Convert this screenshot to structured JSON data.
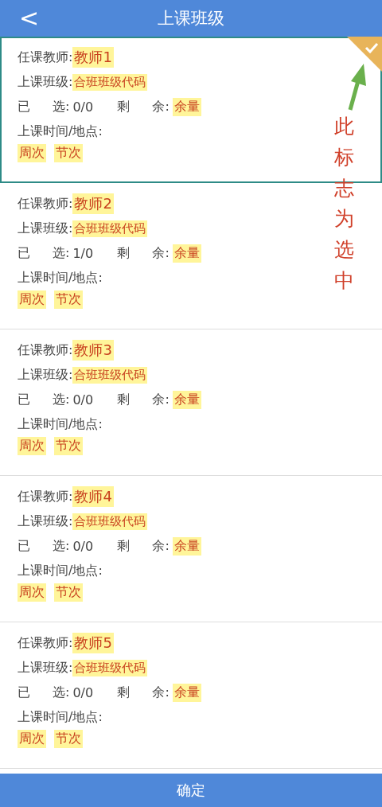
{
  "header": {
    "back": "<",
    "title": "上课班级"
  },
  "classes": [
    {
      "teacher_label": "任课教师:",
      "teacher": "教师1",
      "class_label": "上课班级:",
      "class_code": "合班班级代码",
      "chosen_label": [
        "已",
        "选:"
      ],
      "chosen": "0/0",
      "remain_label": [
        "剩",
        "余:"
      ],
      "remain": "余量",
      "time_label": "上课时间/地点:",
      "week": "周次",
      "section": "节次",
      "selected": true
    },
    {
      "teacher_label": "任课教师:",
      "teacher": "教师2",
      "class_label": "上课班级:",
      "class_code": "合班班级代码",
      "chosen_label": [
        "已",
        "选:"
      ],
      "chosen": "1/0",
      "remain_label": [
        "剩",
        "余:"
      ],
      "remain": "余量",
      "time_label": "上课时间/地点:",
      "week": "周次",
      "section": "节次",
      "selected": false
    },
    {
      "teacher_label": "任课教师:",
      "teacher": "教师3",
      "class_label": "上课班级:",
      "class_code": "合班班级代码",
      "chosen_label": [
        "已",
        "选:"
      ],
      "chosen": "0/0",
      "remain_label": [
        "剩",
        "余:"
      ],
      "remain": "余量",
      "time_label": "上课时间/地点:",
      "week": "周次",
      "section": "节次",
      "selected": false
    },
    {
      "teacher_label": "任课教师:",
      "teacher": "教师4",
      "class_label": "上课班级:",
      "class_code": "合班班级代码",
      "chosen_label": [
        "已",
        "选:"
      ],
      "chosen": "0/0",
      "remain_label": [
        "剩",
        "余:"
      ],
      "remain": "余量",
      "time_label": "上课时间/地点:",
      "week": "周次",
      "section": "节次",
      "selected": false
    },
    {
      "teacher_label": "任课教师:",
      "teacher": "教师5",
      "class_label": "上课班级:",
      "class_code": "合班班级代码",
      "chosen_label": [
        "已",
        "选:"
      ],
      "chosen": "0/0",
      "remain_label": [
        "剩",
        "余:"
      ],
      "remain": "余量",
      "time_label": "上课时间/地点:",
      "week": "周次",
      "section": "节次",
      "selected": false
    }
  ],
  "annotation": "此标志为选中",
  "confirm_button": "确定"
}
